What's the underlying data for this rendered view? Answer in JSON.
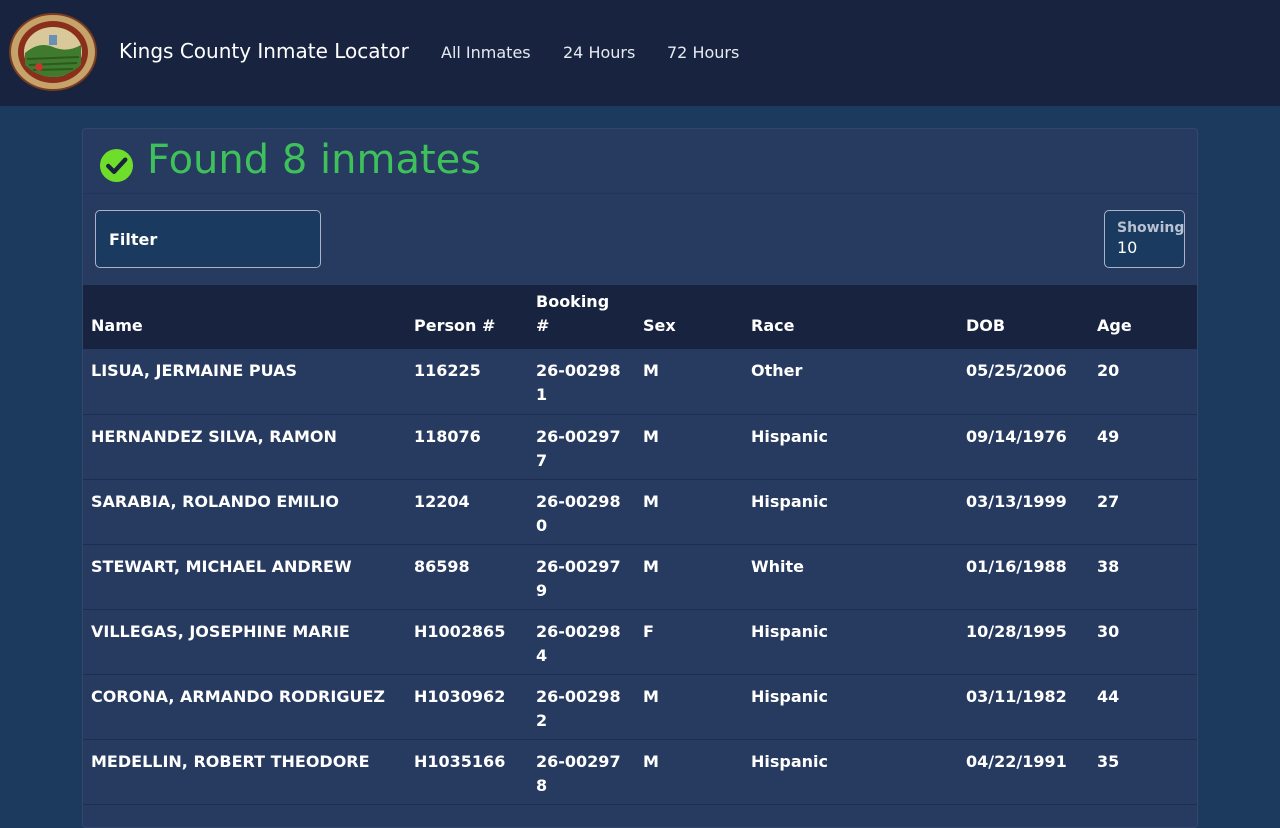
{
  "header": {
    "brand": "Kings County Inmate Locator",
    "nav": [
      "All Inmates",
      "24 Hours",
      "72 Hours"
    ],
    "logo_icon": "county-seal-logo",
    "colors": {
      "navbar_bg": "#18243f",
      "page_bg": "#1c3a5e"
    }
  },
  "results": {
    "title": "Found 8 inmates",
    "status_icon": "check-circle-icon",
    "accent_color": "#3ec15b"
  },
  "controls": {
    "filter_label": "Filter",
    "showing_label": "Showing",
    "showing_value": "10"
  },
  "table": {
    "headers": [
      "Name",
      "Person #",
      "Booking #",
      "Sex",
      "Race",
      "DOB",
      "Age"
    ],
    "rows": [
      [
        "LISUA, JERMAINE PUAS",
        "116225",
        "26-002981",
        "M",
        "Other",
        "05/25/2006",
        "20"
      ],
      [
        "HERNANDEZ SILVA, RAMON",
        "118076",
        "26-002977",
        "M",
        "Hispanic",
        "09/14/1976",
        "49"
      ],
      [
        "SARABIA, ROLANDO EMILIO",
        "12204",
        "26-002980",
        "M",
        "Hispanic",
        "03/13/1999",
        "27"
      ],
      [
        "STEWART, MICHAEL ANDREW",
        "86598",
        "26-002979",
        "M",
        "White",
        "01/16/1988",
        "38"
      ],
      [
        "VILLEGAS, JOSEPHINE MARIE",
        "H1002865",
        "26-002984",
        "F",
        "Hispanic",
        "10/28/1995",
        "30"
      ],
      [
        "CORONA, ARMANDO RODRIGUEZ",
        "H1030962",
        "26-002982",
        "M",
        "Hispanic",
        "03/11/1982",
        "44"
      ],
      [
        "MEDELLIN, ROBERT THEODORE",
        "H1035166",
        "26-002978",
        "M",
        "Hispanic",
        "04/22/1991",
        "35"
      ]
    ]
  }
}
